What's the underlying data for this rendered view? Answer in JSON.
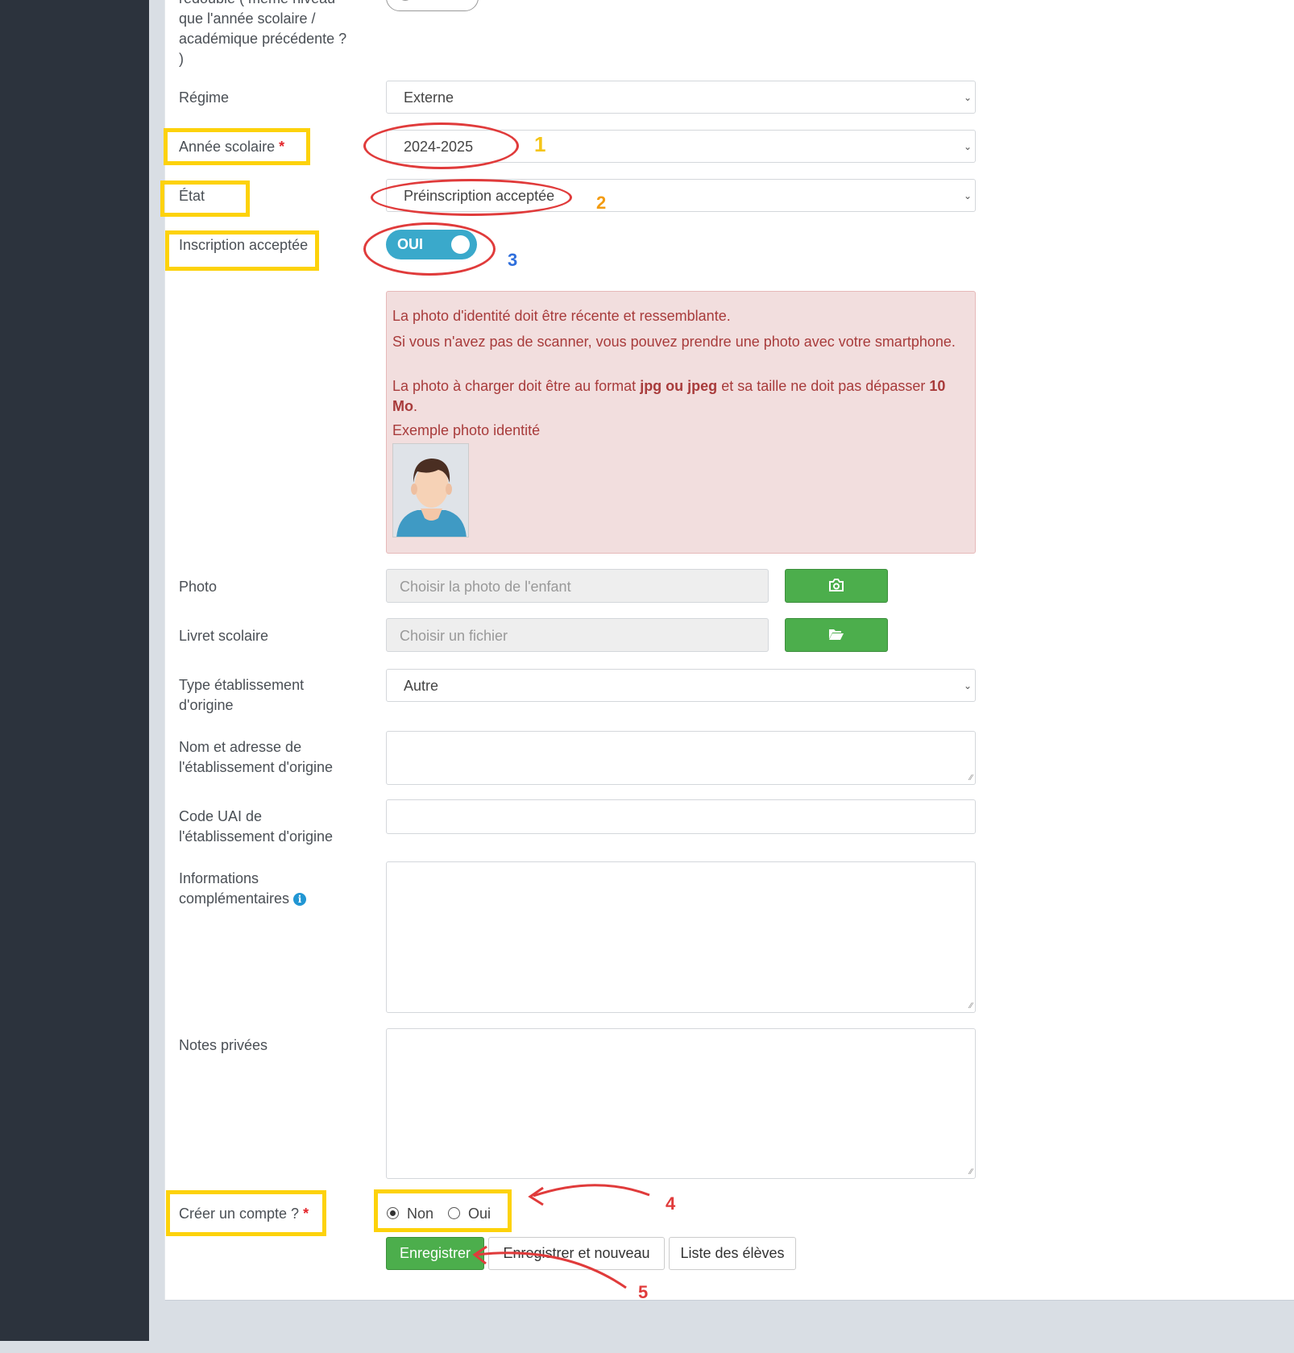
{
  "form": {
    "prev_question": {
      "line1": "redoublé ( même niveau",
      "line2": "que l'année scolaire /",
      "line3": "académique précédente ?",
      "line4": ")"
    },
    "regime": {
      "label": "Régime",
      "value": "Externe"
    },
    "annee": {
      "label": "Année scolaire",
      "required": "*",
      "value": "2024-2025"
    },
    "etat": {
      "label": "État",
      "value": "Préinscription acceptée"
    },
    "inscription": {
      "label": "Inscription acceptée",
      "toggle_text": "OUI"
    },
    "alert": {
      "line1": "La photo d'identité doit être récente et ressemblante.",
      "line2": "Si vous n'avez pas de scanner, vous pouvez prendre une photo avec votre smartphone.",
      "line3_pre": "La photo à charger doit être au format ",
      "line3_bold1": "jpg ou jpeg",
      "line3_mid": " et sa taille ne doit pas dépasser ",
      "line3_bold2": "10 Mo",
      "line3_end": ".",
      "line4": "Exemple photo identité"
    },
    "photo": {
      "label": "Photo",
      "placeholder": "Choisir la photo de l'enfant",
      "button_icon": "camera-icon"
    },
    "livret": {
      "label": "Livret scolaire",
      "placeholder": "Choisir un fichier",
      "button_icon": "folder-open-icon"
    },
    "type_etab": {
      "label_l1": "Type établissement",
      "label_l2": "d'origine",
      "value": "Autre"
    },
    "nom_adresse": {
      "label_l1": "Nom et adresse de",
      "label_l2": "l'établissement d'origine"
    },
    "code_uai": {
      "label_l1": "Code UAI de",
      "label_l2": "l'établissement d'origine"
    },
    "infos": {
      "label_l1": "Informations",
      "label_l2": "complémentaires",
      "icon": "info-icon"
    },
    "notes": {
      "label": "Notes privées"
    },
    "compte": {
      "label": "Créer un compte ?",
      "required": "*",
      "options": [
        "Non",
        "Oui"
      ],
      "selected": "Non"
    },
    "buttons": {
      "save": "Enregistrer",
      "save_new": "Enregistrer et nouveau",
      "list": "Liste des élèves"
    }
  },
  "annotations": {
    "n1": "1",
    "n2": "2",
    "n3": "3",
    "n4": "4",
    "n5": "5"
  },
  "colors": {
    "highlight_box": "#fdd20b",
    "annotation_red": "#e03b3b",
    "num1": "#f5c518",
    "num2": "#f39c12",
    "num3": "#2f6fdc",
    "toggle": "#3aa9cb",
    "green": "#4cae4c",
    "sidebar": "#2c333d"
  }
}
